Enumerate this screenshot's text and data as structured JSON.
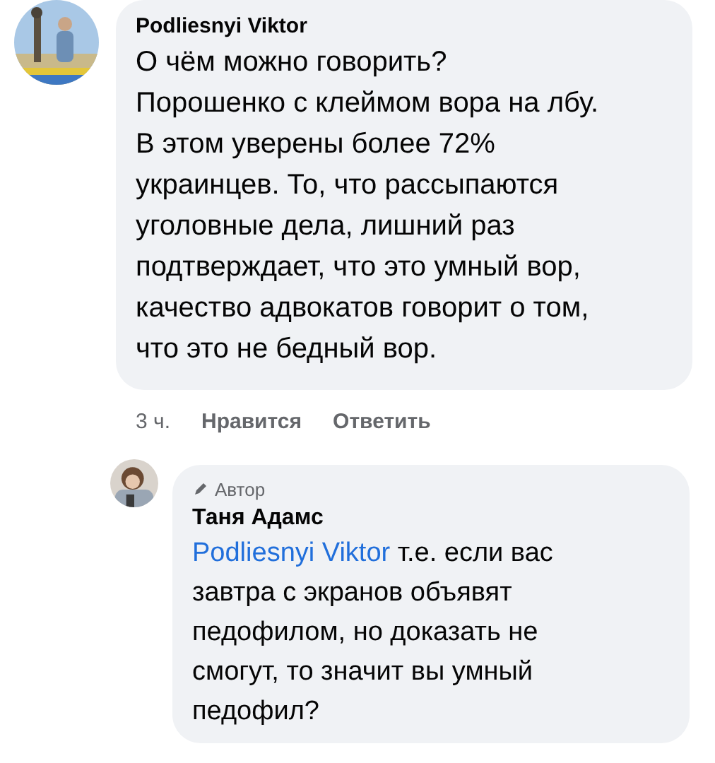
{
  "comments": [
    {
      "author": "Podliesnyi Viktor",
      "text": "О чём можно говорить?\nПорошенко с клеймом вора на лбу.\nВ этом уверены более 72%\nукраинцев. То, что рассыпаются\nуголовные дела, лишний раз\nподтверждает, что это умный вор,\nкачество адвокатов говорит о том,\nчто это не бедный вор.",
      "time": "3 ч.",
      "actions": [
        "Нравится",
        "Ответить"
      ]
    }
  ],
  "reply": {
    "badge": "Автор",
    "author": "Таня Адамс",
    "mention": "Podliesnyi Viktor",
    "text": " т.е. если вас\nзавтра с экранов объявят\nпедофилом, но доказать не\nсмогут, то значит вы умный\nпедофил?"
  }
}
